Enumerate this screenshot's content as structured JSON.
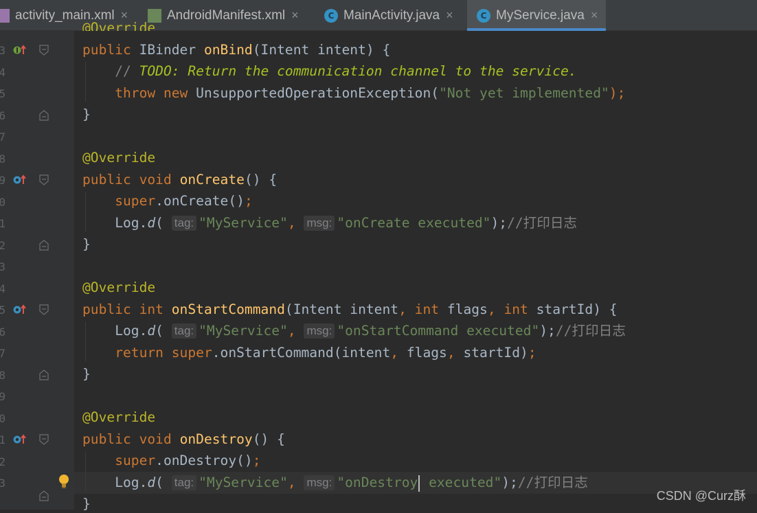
{
  "tabs": [
    {
      "label": "activity_main.xml",
      "icon": "xml-file-icon",
      "active": false
    },
    {
      "label": "AndroidManifest.xml",
      "icon": "manifest-file-icon",
      "active": false
    },
    {
      "label": "MainActivity.java",
      "icon": "java-class-icon",
      "active": false
    },
    {
      "label": "MyService.java",
      "icon": "java-class-icon",
      "active": true
    }
  ],
  "tab_close_glyph": "×",
  "gutter": {
    "line_numbers": [
      "3",
      "4",
      "5",
      "6",
      "7",
      "8",
      "9",
      "0",
      "1",
      "2",
      "3",
      "4",
      "5",
      "6",
      "7",
      "8",
      "9",
      "0",
      "1",
      "2",
      "3"
    ],
    "override_icon": "override-method-icon",
    "implement_icon": "implement-method-icon",
    "bulb_icon": "lightbulb-icon"
  },
  "code": {
    "top_partial": "@Override",
    "onbind_sig": {
      "kw": "public",
      "type": "IBinder",
      "name": "onBind",
      "params": "(Intent intent) {"
    },
    "todo_comment": {
      "prefix": "// ",
      "todo": "TODO: Return the communication channel to the service."
    },
    "throw_line": {
      "throw_kw": "throw",
      "new_kw": "new",
      "cls": "UnsupportedOperationException(",
      "str": "\"Not yet implemented\"",
      "end": ");"
    },
    "close_brace": "}",
    "annotation": "@Override",
    "oncreate_sig": {
      "kw1": "public",
      "kw2": "void",
      "name": "onCreate",
      "rest": "() {"
    },
    "super_oncreate": {
      "kw": "super",
      "call": ".onCreate()",
      "semi": ";"
    },
    "log_d": {
      "cls": "Log.",
      "method": "d",
      "open": "(",
      "tag_hint": "tag:",
      "tag_value": "\"MyService\"",
      "comma": ",",
      "msg_hint": "msg:"
    },
    "oncreate_msg": "\"onCreate executed\"",
    "log_end": ");",
    "log_comment": "//打印日志",
    "onstart_sig": {
      "kw1": "public",
      "kw2": "int",
      "name": "onStartCommand",
      "p1": "(Intent intent",
      "c1": ",",
      "kw3": "int",
      "p2": " flags",
      "c2": ",",
      "kw4": "int",
      "p3": " startId) {"
    },
    "onstart_msg": "\"onStartCommand executed\"",
    "return_line": {
      "ret": "return",
      "sup": "super",
      "call": ".onStartCommand(intent",
      "c1": ",",
      "a2": " flags",
      "c2": ",",
      "a3": " startId)",
      "semi": ";"
    },
    "ondestroy_sig": {
      "kw1": "public",
      "kw2": "void",
      "name": "onDestroy",
      "rest": "() {"
    },
    "super_ondestroy": {
      "kw": "super",
      "call": ".onDestroy()",
      "semi": ";"
    },
    "ondestroy_msg_a": "\"onDestroy",
    "ondestroy_msg_b": " executed\""
  },
  "watermark": "CSDN @Curz酥",
  "colors": {
    "keyword": "#cc7832",
    "annotation": "#bbb529",
    "method_decl": "#ffc66d",
    "string": "#6a8759",
    "comment": "#808080",
    "todo": "#a8c023",
    "text": "#a9b7c6",
    "background": "#2b2b2b",
    "tab_active_underline": "#4a88c7"
  }
}
